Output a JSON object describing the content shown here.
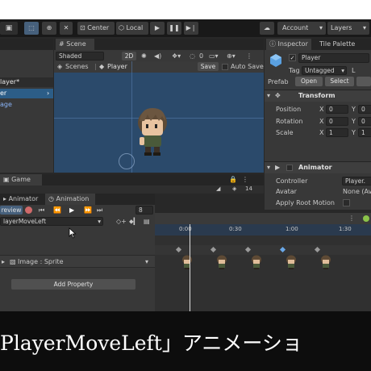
{
  "toolbar": {
    "pivot_center_label": "Center",
    "pivot_local_label": "Local",
    "account_label": "Account",
    "layers_label": "Layers"
  },
  "hierarchy": {
    "items": [
      "layer*",
      "er",
      "age"
    ]
  },
  "scene": {
    "tab_label": "Scene",
    "shading_mode": "Shaded",
    "mode_2d": "2D",
    "gizmo_count": "0",
    "breadcrumb_root": "Scenes",
    "breadcrumb_item": "Player",
    "save_label": "Save",
    "auto_save_label": "Auto Save"
  },
  "inspector": {
    "tab_label": "Inspector",
    "tile_palette_label": "Tile Palette",
    "object_name": "Player",
    "tag_label": "Tag",
    "tag_value": "Untagged",
    "layer_label": "L",
    "prefab_label": "Prefab",
    "open_label": "Open",
    "select_label": "Select",
    "transform_label": "Transform",
    "position_label": "Position",
    "rotation_label": "Rotation",
    "scale_label": "Scale",
    "x_label": "X",
    "y_label": "Y",
    "pos_x": "0",
    "pos_y": "0",
    "rot_x": "0",
    "rot_y": "0",
    "scale_x": "1",
    "scale_y": "1",
    "animator_label": "Animator",
    "controller_label": "Controller",
    "controller_value": "Player.",
    "avatar_label": "Avatar",
    "avatar_value": "None (Av",
    "apply_root_label": "Apply Root Motion"
  },
  "game": {
    "tab_label": "Game",
    "count": "14"
  },
  "animation": {
    "animator_tab": "Animator",
    "animation_tab": "Animation",
    "preview_label": "review",
    "sample_value": "8",
    "clip_name": "layerMoveLeft",
    "property_label": "Image : Sprite",
    "add_property_label": "Add Property",
    "time_labels": [
      "0:00",
      "0:30",
      "1:00",
      "1:30"
    ]
  },
  "caption": {
    "text": "PlayerMoveLeft」アニメーショ"
  },
  "colors": {
    "editor_bg": "#282828",
    "panel_bg": "#383838",
    "scene_bg": "#2b4a6b",
    "accent_blue": "#46607c",
    "playhead": "#e0e0e0"
  }
}
